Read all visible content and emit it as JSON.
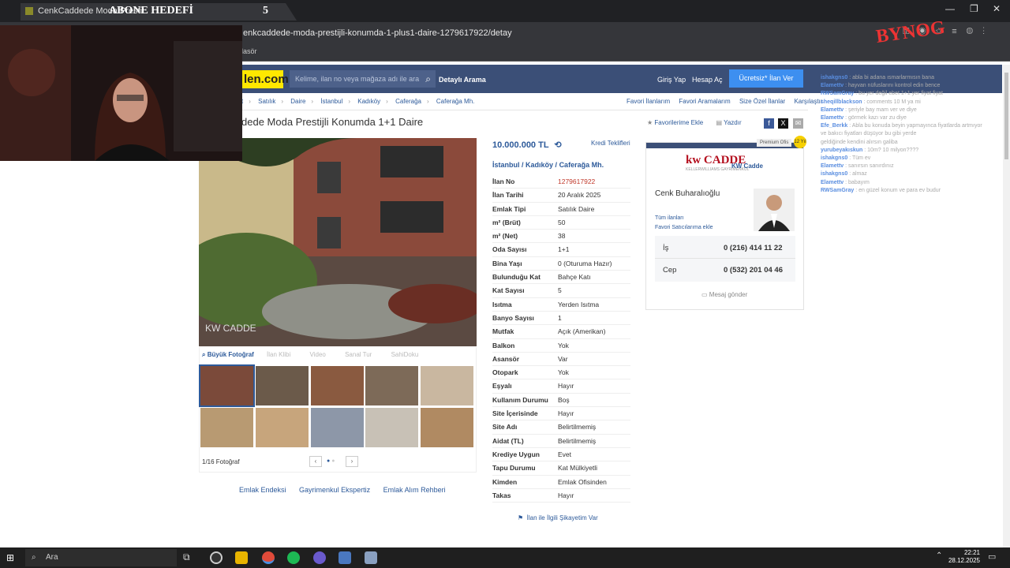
{
  "browser": {
    "tab_title": "CenkCaddede Moda Presti",
    "goal_label": "ABONE HEDEFİ",
    "goal_value": "5",
    "url": "enkcaddede-moda-prestijli-konumda-1-plus1-daire-1279617922/detay",
    "bookmark": "lasör"
  },
  "header": {
    "logo": "len.com",
    "search_placeholder": "Kelime, ilan no veya mağaza adı ile ara",
    "detailed_search": "Detaylı Arama",
    "login": "Giriş Yap",
    "register": "Hesap Aç",
    "post_ad": "Ücretsiz* İlan Ver"
  },
  "breadcrumb": [
    "t",
    "Satılık",
    "Daire",
    "İstanbul",
    "Kadıköy",
    "Caferağa",
    "Caferağa Mh."
  ],
  "top_links": [
    "Favori İlanlarım",
    "Favori Aramalarım",
    "Size Özel İlanlar",
    "Karşılaştır"
  ],
  "listing": {
    "title": "dede Moda Prestijli Konumda 1+1 Daire",
    "add_favorite": "Favorilerime Ekle",
    "print": "Yazdır",
    "price": "10.000.000 TL",
    "loan_offers": "Kredi Teklifleri",
    "location": [
      "İstanbul",
      "Kadıköy",
      "Caferağa Mh."
    ],
    "photo_tabs": [
      "Büyük Fotoğraf",
      "İlan Klibi",
      "Video",
      "Sanal Tur",
      "SahiDoku"
    ],
    "photo_counter": "1/16 Fotoğraf",
    "bottom_links": [
      "Emlak Endeksi",
      "Gayrimenkul Ekspertiz",
      "Emlak Alım Rehberi"
    ],
    "report": "İlan ile İlgili Şikayetim Var",
    "details": [
      {
        "k": "İlan No",
        "v": "1279617922"
      },
      {
        "k": "İlan Tarihi",
        "v": "20 Aralık 2025"
      },
      {
        "k": "Emlak Tipi",
        "v": "Satılık Daire"
      },
      {
        "k": "m² (Brüt)",
        "v": "50"
      },
      {
        "k": "m² (Net)",
        "v": "38"
      },
      {
        "k": "Oda Sayısı",
        "v": "1+1"
      },
      {
        "k": "Bina Yaşı",
        "v": "0 (Oturuma Hazır)"
      },
      {
        "k": "Bulunduğu Kat",
        "v": "Bahçe Katı"
      },
      {
        "k": "Kat Sayısı",
        "v": "5"
      },
      {
        "k": "Isıtma",
        "v": "Yerden Isıtma"
      },
      {
        "k": "Banyo Sayısı",
        "v": "1"
      },
      {
        "k": "Mutfak",
        "v": "Açık (Amerikan)"
      },
      {
        "k": "Balkon",
        "v": "Yok"
      },
      {
        "k": "Asansör",
        "v": "Var"
      },
      {
        "k": "Otopark",
        "v": "Yok"
      },
      {
        "k": "Eşyalı",
        "v": "Hayır"
      },
      {
        "k": "Kullanım Durumu",
        "v": "Boş"
      },
      {
        "k": "Site İçerisinde",
        "v": "Hayır"
      },
      {
        "k": "Site Adı",
        "v": "Belirtilmemiş"
      },
      {
        "k": "Aidat (TL)",
        "v": "Belirtilmemiş"
      },
      {
        "k": "Krediye Uygun",
        "v": "Evet"
      },
      {
        "k": "Tapu Durumu",
        "v": "Kat Mülkiyetli"
      },
      {
        "k": "Kimden",
        "v": "Emlak Ofisinden"
      },
      {
        "k": "Takas",
        "v": "Hayır"
      }
    ]
  },
  "agent": {
    "premium": "Premium Ofis",
    "badge": "12 Yıl",
    "logo": "kw CADDE",
    "logo_sub": "KELLERWILLIAMS GAYRİMENKUL",
    "office": "KW Cadde",
    "name": "Cenk Buharalıoğlu",
    "all_ads": "Tüm ilanları",
    "fav_seller": "Favori Satıcılarıma ekle",
    "work_label": "İş",
    "work_phone": "0 (216) 414 11 22",
    "mobile_label": "Cep",
    "mobile_phone": "0 (532) 201 04 46",
    "message": "Mesaj gönder"
  },
  "chat": [
    {
      "user": "ishakgns0",
      "msg": "abla bi adana ısmarlarmısın bana"
    },
    {
      "user": "Elamettv",
      "msg": "hayvan nüfuslarını kontrol edin bence"
    },
    {
      "user": "RWSamGray",
      "msg": "bu yer değil ebet 1+1 yer fiyat fiyat"
    },
    {
      "user": "sheqillblackson",
      "msg": "comments 10 M ya mi"
    },
    {
      "user": "Elamettv",
      "msg": "şeriyle bay mam ver ve diye"
    },
    {
      "user": "Elamettv",
      "msg": "görmek kazı var zu diye"
    },
    {
      "user": "Efe_Berkk",
      "msg": "Abla bu konuda beyin yapmayınca fiyatlarda artmıyor"
    },
    {
      "user": "",
      "msg": "ve bakıcı fiyatları düşüyor bu gibi yerde"
    },
    {
      "user": "",
      "msg": "geldiğinde kendini alırsın galiba"
    },
    {
      "user": "yurubeyakıskun",
      "msg": "10m? 10 milyon????"
    },
    {
      "user": "ishakgns0",
      "msg": "Tüm ev"
    },
    {
      "user": "Elamettv",
      "msg": "sanırsın sanırdınız"
    },
    {
      "user": "ishakgns0",
      "msg": "almaz"
    },
    {
      "user": "Elamettv",
      "msg": "babayım"
    },
    {
      "user": "RWSamGray",
      "msg": "en güzel konum ve para ev budur"
    }
  ],
  "overlay": {
    "logo": "BYNOG"
  },
  "taskbar": {
    "search": "Ara",
    "time": "22:21",
    "date": "28.12.2025"
  }
}
